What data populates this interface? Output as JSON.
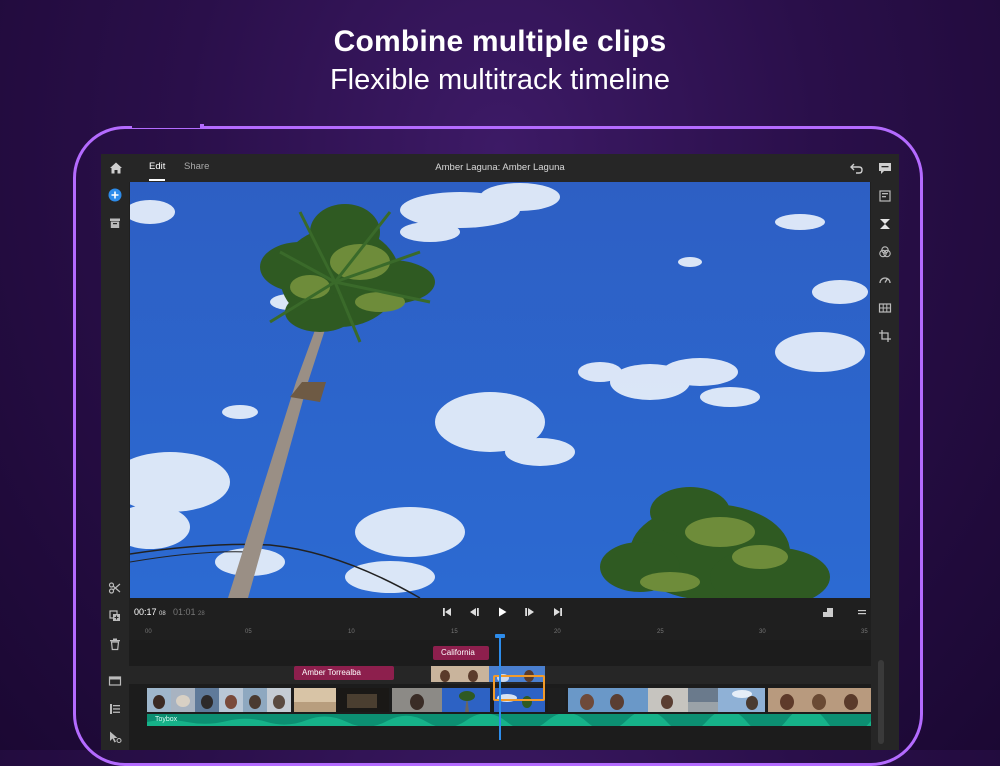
{
  "headline": {
    "title": "Combine multiple clips",
    "subtitle": "Flexible multitrack timeline"
  },
  "app": {
    "tabs": [
      {
        "label": "Edit",
        "active": true
      },
      {
        "label": "Share",
        "active": false
      }
    ],
    "project_title": "Amber Laguna: Amber Laguna"
  },
  "icons": {
    "top": [
      "home-icon",
      "undo-icon",
      "chat-icon"
    ],
    "left_rail": [
      "add-media-icon",
      "archive-icon",
      "split-icon",
      "duplicate-icon",
      "delete-icon",
      "title-track-icon",
      "list-icon",
      "select-icon"
    ],
    "right_rail": [
      "titles-icon",
      "transitions-icon",
      "color-icon",
      "speed-icon",
      "grid-icon",
      "crop-icon"
    ]
  },
  "transport": {
    "current_time": "00:17",
    "current_frames": "08",
    "duration": "01:01",
    "duration_frames": "28"
  },
  "ruler_ticks": [
    "00",
    "05",
    "10",
    "15",
    "20",
    "25",
    "30",
    "35"
  ],
  "timeline": {
    "title_clips": [
      "California",
      "Amber Torrealba"
    ],
    "audio_track_label": "Toybox"
  },
  "colors": {
    "accent_blue": "#2d8ceb",
    "title_clip": "#8d1f4d",
    "audio_track": "#0c8f72",
    "selected_clip": "#f29b2a",
    "device_outline": "#b46bff"
  }
}
